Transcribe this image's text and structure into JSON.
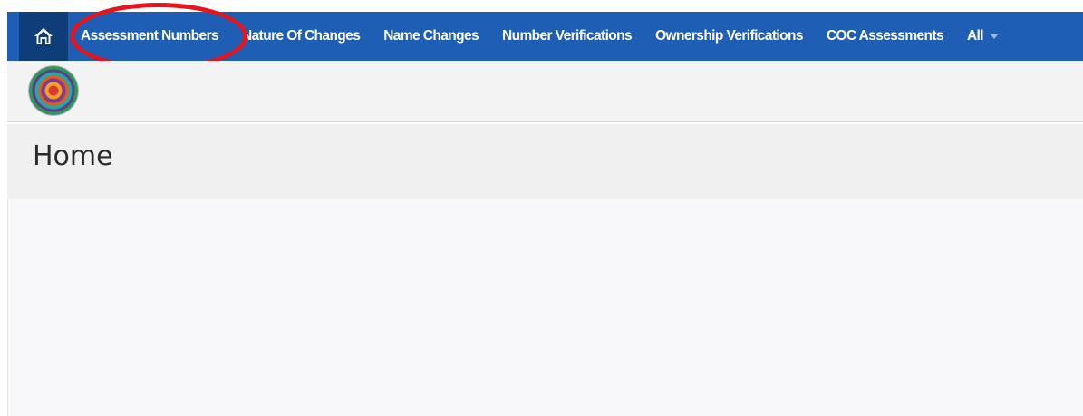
{
  "navbar": {
    "home_icon": "home-icon",
    "items": [
      {
        "label": "Assessment Numbers",
        "highlighted": true
      },
      {
        "label": "Nature Of Changes"
      },
      {
        "label": "Name Changes"
      },
      {
        "label": "Number Verifications"
      },
      {
        "label": "Ownership Verifications"
      },
      {
        "label": "COC Assessments"
      },
      {
        "label": "All",
        "dropdown": true
      }
    ],
    "colors": {
      "bar": "#1e5fb5",
      "home_bg": "#0f3d7a",
      "highlight": "#e8141c"
    }
  },
  "branding": {
    "logo_icon": "mandala-logo-icon"
  },
  "page": {
    "title": "Home"
  }
}
